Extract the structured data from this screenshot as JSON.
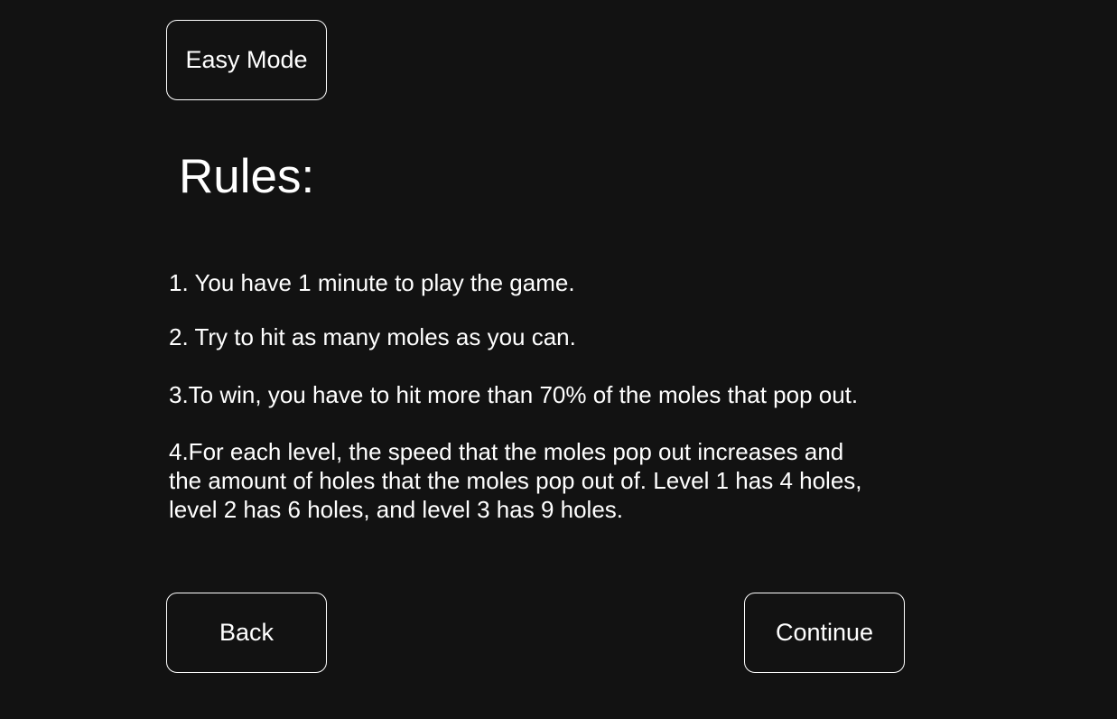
{
  "header": {
    "mode_label": "Easy Mode"
  },
  "rules": {
    "title": "Rules:",
    "items": [
      "1. You have 1 minute to play the game.",
      "2. Try to hit as many moles as you can.",
      "3.To win, you have to hit more than 70% of the moles that pop out.",
      "4.For each level, the speed that the moles pop out increases and\nthe amount of holes that the moles pop out of. Level 1 has 4 holes,\nlevel 2 has 6 holes, and level 3 has 9 holes."
    ]
  },
  "footer": {
    "back_label": "Back",
    "continue_label": "Continue"
  },
  "colors": {
    "background": "#121212",
    "text": "#ffffff",
    "button_border": "#ffffff"
  }
}
